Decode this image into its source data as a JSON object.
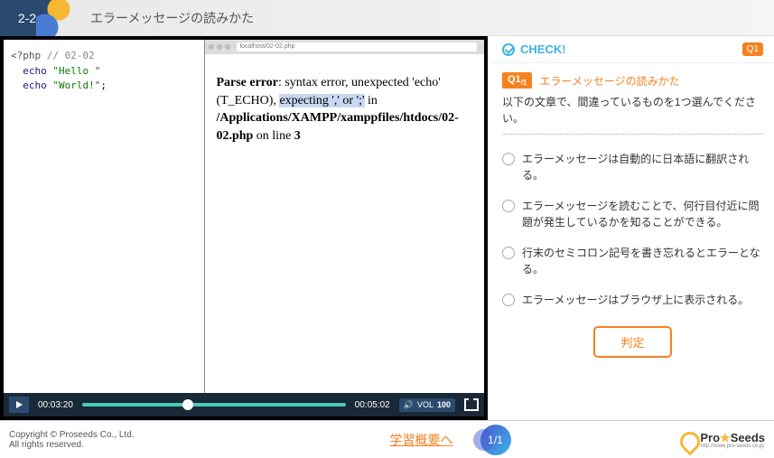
{
  "header": {
    "section": "2-2",
    "title": "エラーメッセージの読みかた"
  },
  "code": {
    "open": "<?php",
    "comment": "// 02-02",
    "line1_kw": "echo",
    "line1_str": "\"Hello \"",
    "line2_kw": "echo",
    "line2_str": "\"World!\"",
    "line2_end": ";"
  },
  "browser": {
    "url": "localhost/02-02.php",
    "err_label": "Parse error",
    "err_msg": ": syntax error, unexpected 'echo' (T_ECHO), ",
    "err_hl": "expecting ',' or ';'",
    "err_after": " in ",
    "err_path": "/Applications/XAMPP/xamppfiles/htdocs/02-02.php",
    "err_line_pre": " on line ",
    "err_line": "3"
  },
  "controls": {
    "elapsed": "00:03:20",
    "total": "00:05:02",
    "vol_label": "VOL",
    "vol_val": "100"
  },
  "quiz": {
    "check": "CHECK!",
    "badge": "Q1",
    "qnum": "Q1",
    "qsub": "/1",
    "qtitle": "エラーメッセージの読みかた",
    "prompt": "以下の文章で、間違っているものを1つ選んでください。",
    "options": [
      "エラーメッセージは自動的に日本語に翻訳される。",
      "エラーメッセージを読むことで、何行目付近に問題が発生しているかを知ることができる。",
      "行末のセミコロン記号を書き忘れるとエラーとなる。",
      "エラーメッセージはブラウザ上に表示される。"
    ],
    "judge": "判定"
  },
  "footer": {
    "copyright": "Copyright © Proseeds Co., Ltd.",
    "rights": "All rights reserved.",
    "summary": "学習概要へ",
    "page": "1/1",
    "brand_pre": "Pro",
    "brand_post": "Seeds",
    "brand_url": "http://www.pro-seeds.co.jp"
  }
}
